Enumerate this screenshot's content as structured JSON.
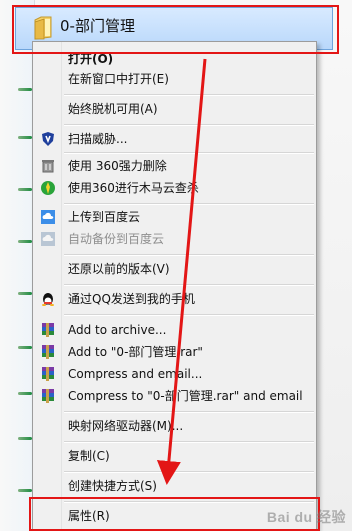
{
  "header": {
    "folder_name": "0-部门管理"
  },
  "menu": {
    "items": [
      {
        "label": "打开(O)",
        "icon": "none"
      },
      {
        "label": "在新窗口中打开(E)",
        "icon": "none"
      },
      {
        "label": "始终脱机可用(A)",
        "icon": "none"
      },
      {
        "label": "扫描威胁...",
        "icon": "shield-icon"
      },
      {
        "label": "使用 360强力删除",
        "icon": "delete-tool-icon"
      },
      {
        "label": "使用360进行木马云查杀",
        "icon": "trojan-scan-icon"
      },
      {
        "label": "上传到百度云",
        "icon": "cloud-upload-icon"
      },
      {
        "label": "自动备份到百度云",
        "icon": "cloud-backup-icon"
      },
      {
        "label": "还原以前的版本(V)",
        "icon": "none"
      },
      {
        "label": "通过QQ发送到我的手机",
        "icon": "qq-icon"
      },
      {
        "label": "Add to archive...",
        "icon": "winrar-icon"
      },
      {
        "label": "Add to \"0-部门管理.rar\"",
        "icon": "winrar-icon"
      },
      {
        "label": "Compress and email...",
        "icon": "winrar-icon"
      },
      {
        "label": "Compress to \"0-部门管理.rar\" and email",
        "icon": "winrar-icon"
      },
      {
        "label": "映射网络驱动器(M)...",
        "icon": "none"
      },
      {
        "label": "复制(C)",
        "icon": "none"
      },
      {
        "label": "创建快捷方式(S)",
        "icon": "none"
      },
      {
        "label": "属性(R)",
        "icon": "none"
      }
    ]
  },
  "colors": {
    "highlight_red": "#e31616",
    "selection_blue": "#b9d8fb"
  },
  "watermark": {
    "text": "Bai du 经验"
  }
}
